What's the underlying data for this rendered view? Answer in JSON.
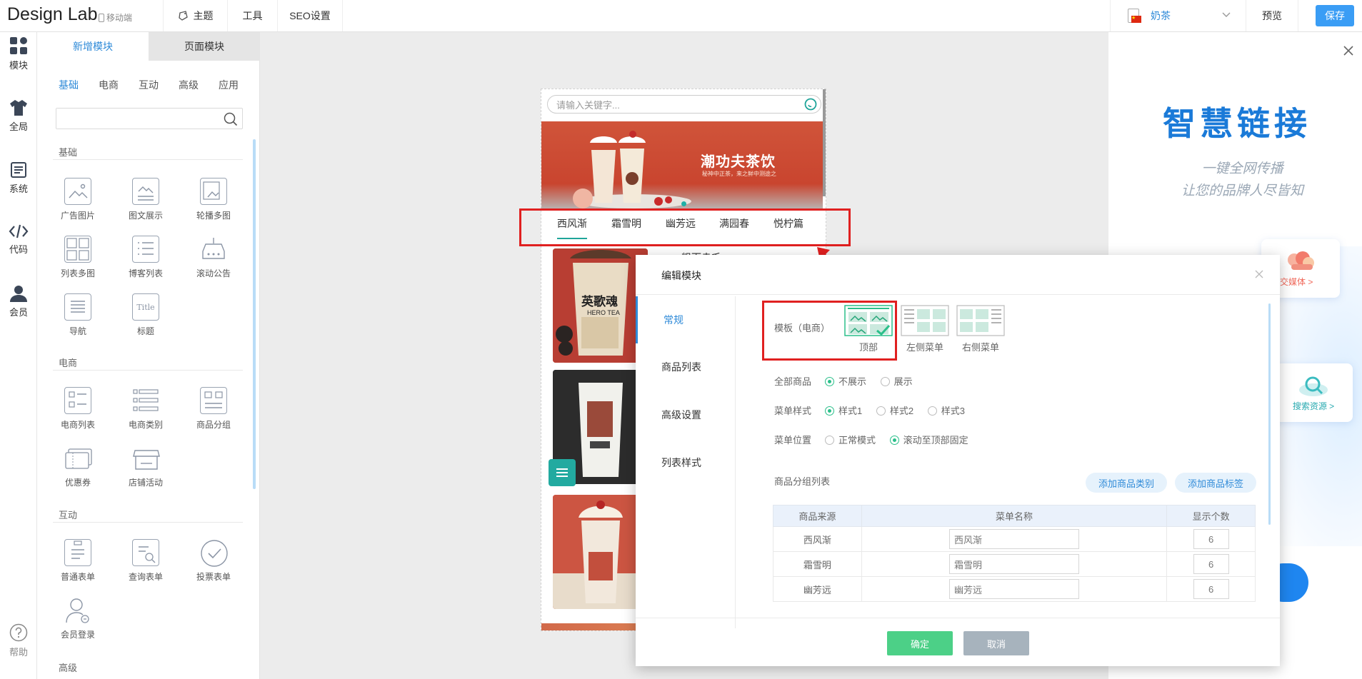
{
  "topbar": {
    "logo": "Design Lab",
    "mobile_label": "移动端",
    "nav": [
      {
        "label": "主题",
        "icon": "theme-icon"
      },
      {
        "label": "工具"
      },
      {
        "label": "SEO设置"
      }
    ],
    "site_name": "奶茶",
    "preview_label": "预览",
    "save_label": "保存"
  },
  "rail": {
    "items": [
      {
        "label": "模块",
        "icon": "grid-icon"
      },
      {
        "label": "全局",
        "icon": "shirt-icon"
      },
      {
        "label": "系统",
        "icon": "document-icon"
      },
      {
        "label": "代码",
        "icon": "code-icon"
      },
      {
        "label": "会员",
        "icon": "user-icon"
      }
    ],
    "help_label": "帮助"
  },
  "panel": {
    "tabs": [
      "新增模块",
      "页面模块"
    ],
    "categories": [
      "基础",
      "电商",
      "互动",
      "高级",
      "应用"
    ],
    "search_value": "",
    "sections": [
      {
        "title": "基础",
        "items": [
          "广告图片",
          "图文展示",
          "轮播多图",
          "列表多图",
          "博客列表",
          "滚动公告",
          "导航",
          "标题"
        ]
      },
      {
        "title": "电商",
        "items": [
          "电商列表",
          "电商类别",
          "商品分组",
          "优惠券",
          "店铺活动"
        ]
      },
      {
        "title": "互动",
        "items": [
          "普通表单",
          "查询表单",
          "投票表单",
          "会员登录"
        ]
      },
      {
        "title": "高级",
        "items": []
      }
    ],
    "title_icon_text": "Title"
  },
  "phone": {
    "search_placeholder": "请输入关键字...",
    "banner_title": "潮功夫茶饮",
    "banner_subtitle": "秘神中正茶，来之鲜中测途之",
    "category_tabs": [
      "西风渐",
      "霜雪明",
      "幽芳远",
      "满园春",
      "悦柠篇"
    ],
    "active_tab": "西风渐",
    "product_title_partial": "粗而赤毛",
    "cup_brand": "英歌魂",
    "cup_brand_en": "HERO TEA"
  },
  "dialog": {
    "title": "编辑模块",
    "side_items": [
      "常规",
      "商品列表",
      "高级设置",
      "列表样式"
    ],
    "template_label": "模板（电商）",
    "templates": [
      "顶部",
      "左侧菜单",
      "右侧菜单"
    ],
    "all_goods_label": "全部商品",
    "all_goods_options": [
      "不展示",
      "展示"
    ],
    "menu_style_label": "菜单样式",
    "menu_style_options": [
      "样式1",
      "样式2",
      "样式3"
    ],
    "menu_pos_label": "菜单位置",
    "menu_pos_options": [
      "正常模式",
      "滚动至顶部固定"
    ],
    "group_list_label": "商品分组列表",
    "add_category_label": "添加商品类别",
    "add_tag_label": "添加商品标签",
    "table_headers": [
      "商品来源",
      "菜单名称",
      "显示个数"
    ],
    "rows": [
      {
        "source": "西风渐",
        "name": "西风渐",
        "count": "6"
      },
      {
        "source": "霜雪明",
        "name": "霜雪明",
        "count": "6"
      },
      {
        "source": "幽芳远",
        "name": "幽芳远",
        "count": "6"
      }
    ],
    "ok_label": "确定",
    "cancel_label": "取消"
  },
  "ad": {
    "headline": "智慧链接",
    "line1": "一键全网传播",
    "line2": "让您的品牌人尽皆知",
    "card1": "社交媒体 >",
    "card2": "搜索资源 >"
  },
  "colors": {
    "accent": "#3a9df5",
    "green": "#2bbf8a",
    "highlight_red": "#e02020",
    "banner": "#cc4a33"
  }
}
